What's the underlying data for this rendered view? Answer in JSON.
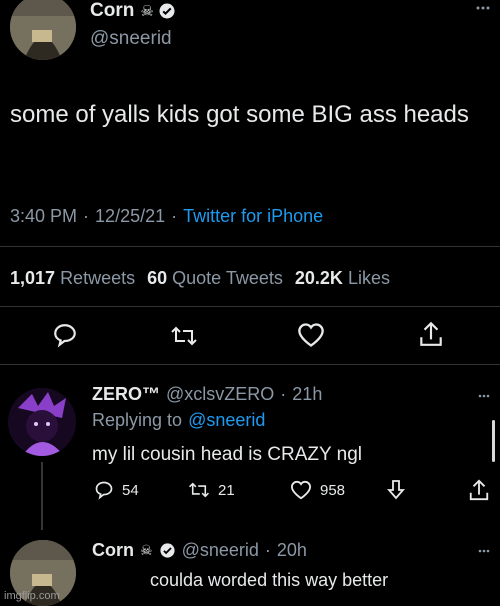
{
  "main_tweet": {
    "author_name": "Corn",
    "author_emoji": "☠",
    "handle": "@sneerid",
    "text": "some of yalls kids got some BIG ass heads",
    "time": "3:40 PM",
    "date": "12/25/21",
    "source": "Twitter for iPhone",
    "retweets_count": "1,017",
    "retweets_label": "Retweets",
    "quote_count": "60",
    "quote_label": "Quote Tweets",
    "likes_count": "20.2K",
    "likes_label": "Likes"
  },
  "reply1": {
    "author_name": "ZERO™",
    "handle": "@xclsvZERO",
    "time": "21h",
    "replying_prefix": "Replying to",
    "replying_handle": "@sneerid",
    "text": "my lil cousin head is CRAZY ngl",
    "reply_count": "54",
    "retweet_count": "21",
    "like_count": "958"
  },
  "reply2": {
    "author_name": "Corn",
    "author_emoji": "☠",
    "handle": "@sneerid",
    "time": "20h",
    "text": "coulda worded this way better"
  },
  "watermark": "imgflip.com",
  "colors": {
    "background": "#000000",
    "text": "#e7e9ea",
    "secondary": "#8b98a5",
    "link": "#1d9bf0",
    "verified": "#e7e9ea"
  }
}
